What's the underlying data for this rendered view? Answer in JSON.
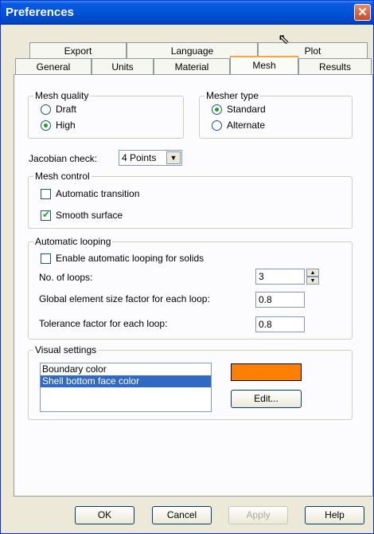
{
  "window": {
    "title": "Preferences"
  },
  "tabs_back": [
    "Export",
    "Language",
    "Plot"
  ],
  "tabs_front": [
    "General",
    "Units",
    "Material",
    "Mesh",
    "Results"
  ],
  "mesh_quality": {
    "legend": "Mesh quality",
    "options": [
      "Draft",
      "High"
    ],
    "selected": "High"
  },
  "mesher_type": {
    "legend": "Mesher type",
    "options": [
      "Standard",
      "Alternate"
    ],
    "selected": "Standard"
  },
  "jacobian": {
    "label": "Jacobian check:",
    "value": "4 Points"
  },
  "mesh_control": {
    "legend": "Mesh control",
    "items": [
      {
        "label": "Automatic transition",
        "checked": false
      },
      {
        "label": "Smooth surface",
        "checked": true
      }
    ]
  },
  "looping": {
    "legend": "Automatic looping",
    "enable_label": "Enable automatic looping for solids",
    "enable_checked": false,
    "loops_label": "No. of loops:",
    "loops_value": "3",
    "global_label": "Global element size factor for each loop:",
    "global_value": "0.8",
    "tolerance_label": "Tolerance factor for each loop:",
    "tolerance_value": "0.8"
  },
  "visual": {
    "legend": "Visual settings",
    "items": [
      "Boundary color",
      "Shell bottom face color"
    ],
    "selected_index": 1,
    "swatch_color": "#ff8000",
    "edit_label": "Edit..."
  },
  "buttons": {
    "ok": "OK",
    "cancel": "Cancel",
    "apply": "Apply",
    "help": "Help"
  }
}
